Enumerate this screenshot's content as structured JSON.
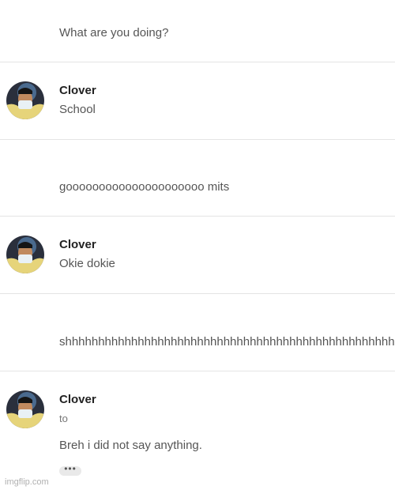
{
  "messages": [
    {
      "text": "What are you doing?"
    },
    {
      "sender": "Clover",
      "text": "School",
      "avatar": "profile-photo"
    },
    {
      "text": "gooooooooooooooooooooo mits"
    },
    {
      "sender": "Clover",
      "text": "Okie dokie",
      "avatar": "profile-photo"
    },
    {
      "text": "shhhhhhhhhhhhhhhhhhhhhhhhhhhhhhhhhhhhhhhhhhhhhhhhhhhhhhhhhhhhhhhhhhhhhh"
    },
    {
      "sender": "Clover",
      "subtext": "to",
      "text": "Breh i did not say anything.",
      "avatar": "profile-photo",
      "more_label": "•••"
    }
  ],
  "watermark": "imgflip.com",
  "colors": {
    "background": "#ffffff",
    "divider": "#e4e4e4",
    "sender": "#222222",
    "body_text": "#555555"
  }
}
